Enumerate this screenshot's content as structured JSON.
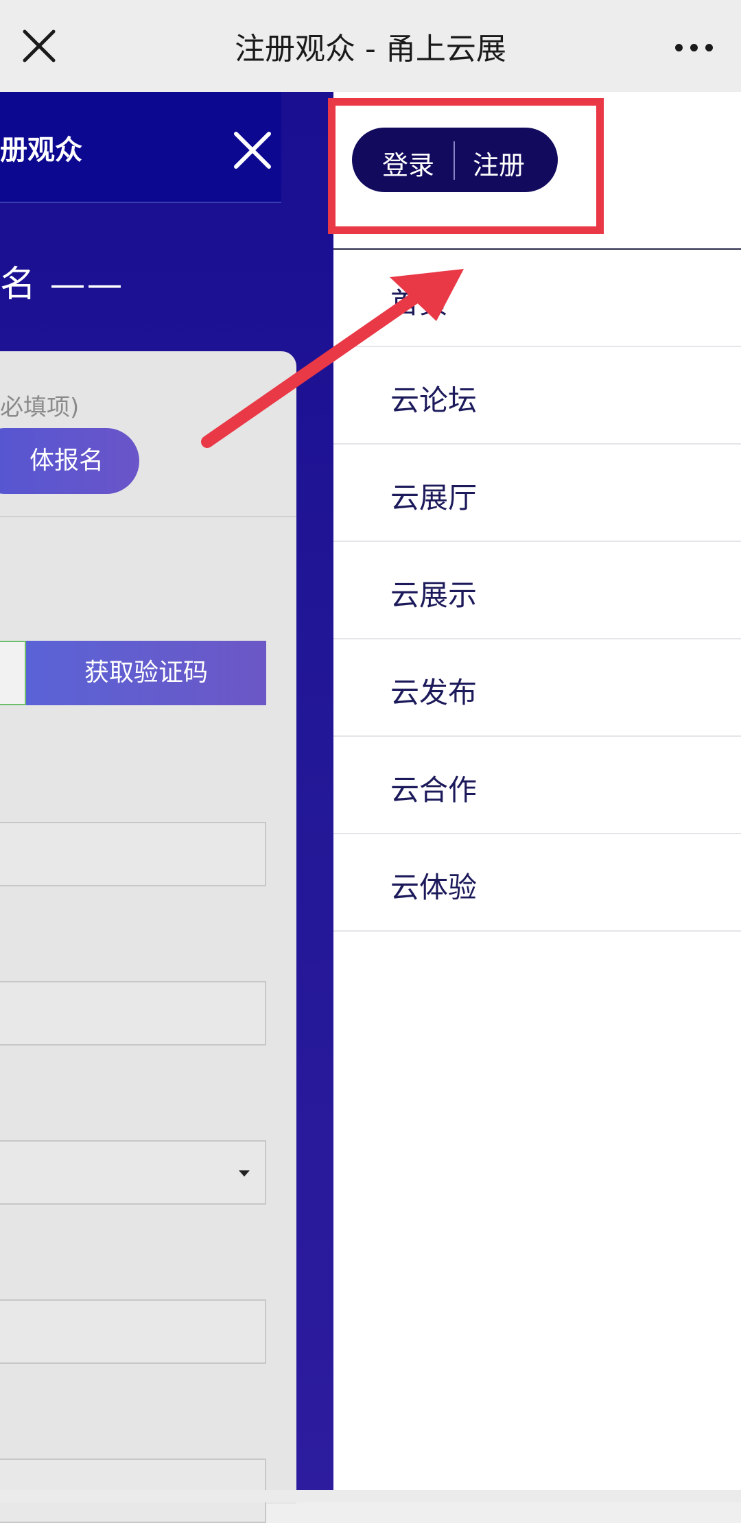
{
  "topbar": {
    "title": "注册观众 - 甬上云展",
    "close_icon": "close-icon",
    "more_icon": "more-dots-icon"
  },
  "background_page": {
    "header_title": "册观众",
    "heading": "名 ——",
    "hint": "必填项)",
    "group_button": "体报名",
    "code_button": "获取验证码"
  },
  "drawer": {
    "login": "登录",
    "register": "注册",
    "menu": [
      {
        "label": "首页"
      },
      {
        "label": "云论坛"
      },
      {
        "label": "云展厅"
      },
      {
        "label": "云展示"
      },
      {
        "label": "云发布"
      },
      {
        "label": "云合作"
      },
      {
        "label": "云体验"
      }
    ]
  },
  "colors": {
    "drawer_bg": "#ffffff",
    "page_bg": "#1a0e91",
    "pill": "#120a5c",
    "annotation": "#e93846"
  }
}
